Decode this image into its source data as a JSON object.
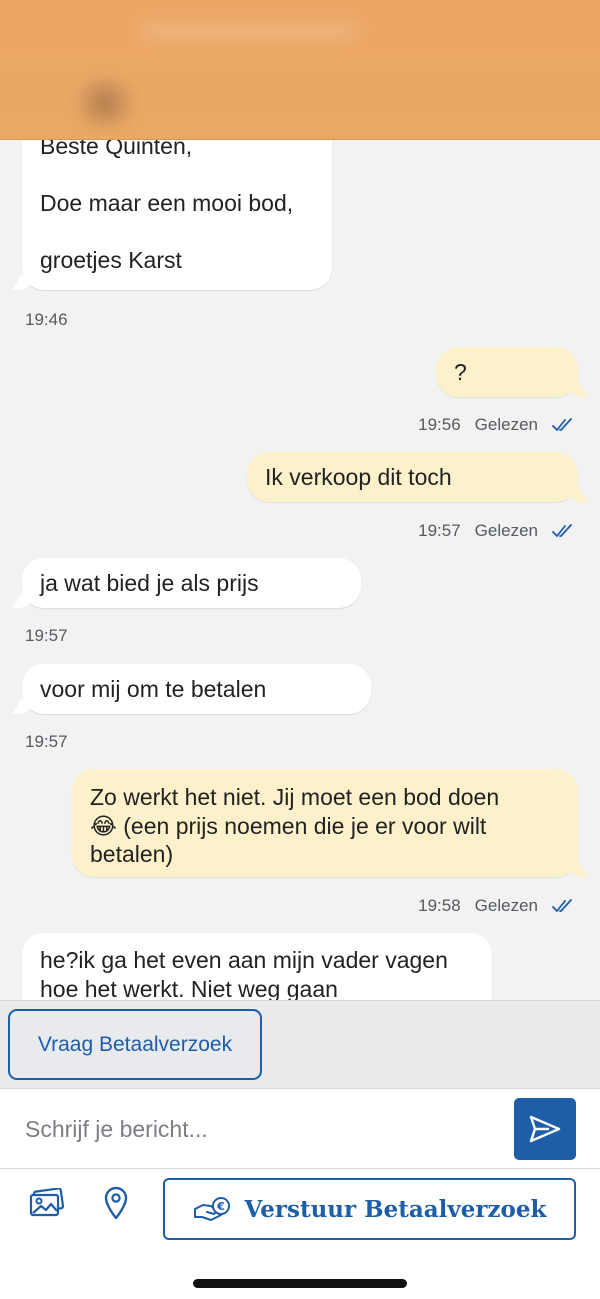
{
  "messages": [
    {
      "lines": [
        "Beste Quinten,",
        "Doe maar een mooi bod,",
        "groetjes Karst"
      ]
    },
    {
      "text": "?"
    },
    {
      "text": "Ik verkoop dit toch"
    },
    {
      "text": "ja wat bied je als prijs"
    },
    {
      "text": "voor mij om te betalen"
    },
    {
      "lines": [
        "Zo werkt het niet. Jij moet een bod doen",
        "😂 (een prijs noemen die je er voor wilt",
        "betalen)"
      ]
    },
    {
      "lines": [
        "he?ik ga het even aan mijn vader vagen",
        "hoe het werkt. Niet weg gaan"
      ]
    }
  ],
  "timestamps": {
    "m1": "19:46",
    "m2": "19:56",
    "m3": "19:57",
    "m4": "19:57",
    "m5": "19:57",
    "m6": "19:58"
  },
  "read_label": "Gelezen",
  "request_button": "Vraag Betaalverzoek",
  "compose": {
    "placeholder": "Schrijf je bericht..."
  },
  "pay_button": "Verstuur Betaalverzoek",
  "colors": {
    "accent": "#1e5ea8",
    "header": "#eba865",
    "outgoing": "#fdf1cc",
    "incoming": "#ffffff"
  }
}
